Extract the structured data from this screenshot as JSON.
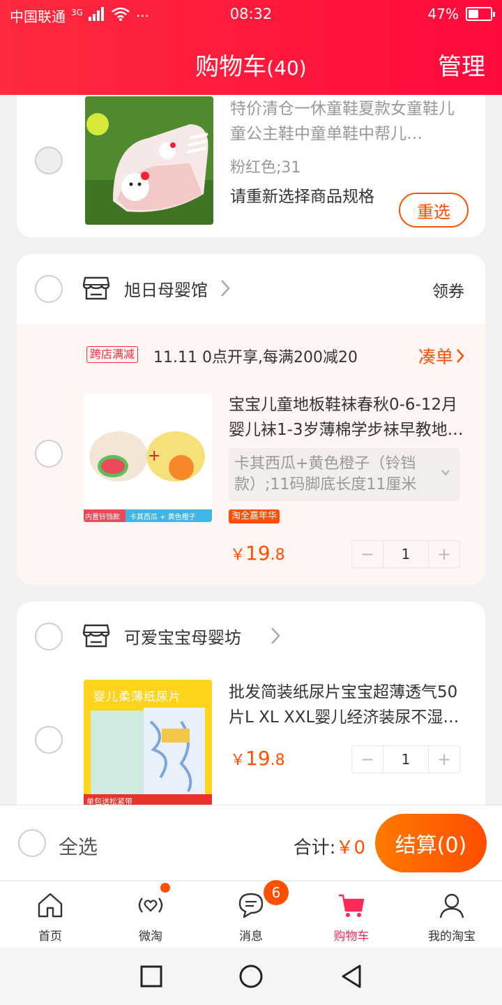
{
  "status_bar": {
    "carrier": "中国联通",
    "network": "3G",
    "dots": "···",
    "time": "08:32",
    "battery_percent": "47%",
    "battery_level": 0.47
  },
  "header": {
    "title": "购物车",
    "count": "(40)",
    "manage": "管理"
  },
  "item_invalid": {
    "title": "特价清仓一休童鞋夏款女童鞋儿童公主鞋中童单鞋中帮儿…",
    "spec": "粉红色;31",
    "notice": "请重新选择商品规格",
    "reselect": "重选"
  },
  "shop1": {
    "name": "旭日母婴馆",
    "coupon": "领券",
    "promo_tag": "跨店满减",
    "promo_text": "11.11 0点开享,每满200减20",
    "promo_link": "凑单",
    "item": {
      "title": "宝宝儿童地板鞋袜春秋0-6-12月婴儿袜1-3岁薄棉学步袜早教地…",
      "spec": "卡其西瓜+黄色橙子（铃铛款）;11码脚底长度11厘米",
      "badge": "淘全嘉年华",
      "currency": "￥",
      "price_int": "19",
      "price_dec": ".8",
      "minus": "−",
      "qty": "1",
      "plus": "+",
      "img_caption_left": "内置铃铛款",
      "img_caption_right": "卡其西瓜 + 黄色橙子"
    }
  },
  "shop2": {
    "name": "可爱宝宝母婴坊",
    "item": {
      "title": "批发简装纸尿片宝宝超薄透气50片L XL XXL婴儿经济装尿不湿…",
      "currency": "￥",
      "price_int": "19",
      "price_dec": ".8",
      "minus": "−",
      "qty": "1",
      "plus": "+",
      "img_banner": "婴儿柔薄纸尿片",
      "img_caption": "单包送松紧带"
    }
  },
  "checkout": {
    "select_all": "全选",
    "total_label": "合计:",
    "total_value": "￥0",
    "button": "结算(0)"
  },
  "tabs": [
    {
      "label": "首页"
    },
    {
      "label": "微淘"
    },
    {
      "label": "消息",
      "badge": "6"
    },
    {
      "label": "购物车"
    },
    {
      "label": "我的淘宝"
    }
  ],
  "colors": {
    "brand_red": "#ff1a3c",
    "accent_orange": "#ff5000",
    "active_tab": "#ff2a5a"
  }
}
